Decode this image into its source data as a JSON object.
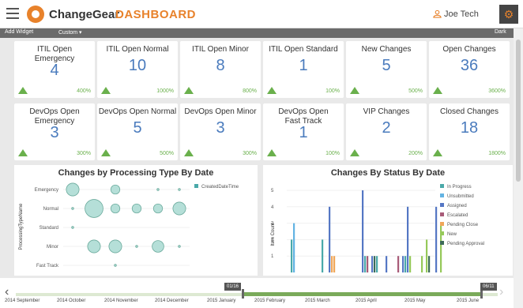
{
  "header": {
    "brand": "ChangeGear",
    "page_title": "DASHBOARD",
    "user_name": "Joe Tech"
  },
  "toolbar": {
    "add_widget": "Add Widget",
    "custom": "Custom ▾",
    "theme": "Dark"
  },
  "cards": [
    {
      "title": "ITIL Open Emergency",
      "value": "4",
      "pct": "400%"
    },
    {
      "title": "ITIL Open Normal",
      "value": "10",
      "pct": "1000%"
    },
    {
      "title": "ITIL Open Minor",
      "value": "8",
      "pct": "800%"
    },
    {
      "title": "ITIL Open Standard",
      "value": "1",
      "pct": "100%"
    },
    {
      "title": "New Changes",
      "value": "5",
      "pct": "500%"
    },
    {
      "title": "Open Changes",
      "value": "36",
      "pct": "3600%"
    },
    {
      "title": "DevOps Open Emergency",
      "value": "3",
      "pct": "300%"
    },
    {
      "title": "DevOps Open Normal",
      "value": "5",
      "pct": "500%"
    },
    {
      "title": "DevOps Open Minor",
      "value": "3",
      "pct": "300%"
    },
    {
      "title": "DevOps Open Fast Track",
      "value": "1",
      "pct": "100%"
    },
    {
      "title": "VIP Changes",
      "value": "2",
      "pct": "200%"
    },
    {
      "title": "Closed Changes",
      "value": "18",
      "pct": "1800%"
    }
  ],
  "chart_data": [
    {
      "type": "scatter",
      "title": "Changes by Processing Type By Date",
      "ylabel": "ProcessingTypeName",
      "categories": [
        "Emergency",
        "Normal",
        "Standard",
        "Minor",
        "Fast Track"
      ],
      "legend": [
        "CreatedDateTime"
      ],
      "legend_position": "top-right",
      "bubbles": [
        {
          "cat": "Emergency",
          "col": 0,
          "size": 6
        },
        {
          "cat": "Emergency",
          "col": 2,
          "size": 3
        },
        {
          "cat": "Emergency",
          "col": 4,
          "size": 1
        },
        {
          "cat": "Emergency",
          "col": 5,
          "size": 1
        },
        {
          "cat": "Normal",
          "col": 0,
          "size": 1
        },
        {
          "cat": "Normal",
          "col": 1,
          "size": 12
        },
        {
          "cat": "Normal",
          "col": 2,
          "size": 3
        },
        {
          "cat": "Normal",
          "col": 3,
          "size": 3
        },
        {
          "cat": "Normal",
          "col": 4,
          "size": 3
        },
        {
          "cat": "Normal",
          "col": 5,
          "size": 6
        },
        {
          "cat": "Standard",
          "col": 0,
          "size": 1
        },
        {
          "cat": "Minor",
          "col": 1,
          "size": 6
        },
        {
          "cat": "Minor",
          "col": 2,
          "size": 6
        },
        {
          "cat": "Minor",
          "col": 3,
          "size": 1
        },
        {
          "cat": "Minor",
          "col": 4,
          "size": 5
        },
        {
          "cat": "Minor",
          "col": 5,
          "size": 1
        },
        {
          "cat": "Fast Track",
          "col": 2,
          "size": 1
        }
      ]
    },
    {
      "type": "bar",
      "title": "Changes By Status By Date",
      "ylabel": "Item Count",
      "ylim": [
        0,
        5
      ],
      "yticks": [
        1,
        2,
        3,
        4,
        5
      ],
      "legend_position": "right",
      "series": [
        {
          "name": "In Progress",
          "color": "#4aa9a9"
        },
        {
          "name": "Unsubmitted",
          "color": "#63b3e3"
        },
        {
          "name": "Assigned",
          "color": "#5577c4"
        },
        {
          "name": "Escalated",
          "color": "#a85b78"
        },
        {
          "name": "Pending Close",
          "color": "#f0a75a"
        },
        {
          "name": "New",
          "color": "#96c95a"
        },
        {
          "name": "Pending Approval",
          "color": "#3d6b58"
        }
      ],
      "bars": [
        {
          "series": 0,
          "slot": 1,
          "value": 2
        },
        {
          "series": 1,
          "slot": 2,
          "value": 3
        },
        {
          "series": 0,
          "slot": 14,
          "value": 2
        },
        {
          "series": 2,
          "slot": 17,
          "value": 4
        },
        {
          "series": 4,
          "slot": 18,
          "value": 1
        },
        {
          "series": 4,
          "slot": 19,
          "value": 1
        },
        {
          "series": 2,
          "slot": 31,
          "value": 5
        },
        {
          "series": 0,
          "slot": 32,
          "value": 1
        },
        {
          "series": 3,
          "slot": 33,
          "value": 1
        },
        {
          "series": 2,
          "slot": 35,
          "value": 1
        },
        {
          "series": 6,
          "slot": 36,
          "value": 1
        },
        {
          "series": 0,
          "slot": 37,
          "value": 1
        },
        {
          "series": 2,
          "slot": 41,
          "value": 1
        },
        {
          "series": 3,
          "slot": 46,
          "value": 1
        },
        {
          "series": 2,
          "slot": 48,
          "value": 1
        },
        {
          "series": 0,
          "slot": 49,
          "value": 1
        },
        {
          "series": 2,
          "slot": 50,
          "value": 4
        },
        {
          "series": 5,
          "slot": 51,
          "value": 1
        },
        {
          "series": 5,
          "slot": 56,
          "value": 1
        },
        {
          "series": 5,
          "slot": 58,
          "value": 2
        },
        {
          "series": 6,
          "slot": 59,
          "value": 1
        },
        {
          "series": 2,
          "slot": 62,
          "value": 4
        },
        {
          "series": 5,
          "slot": 64,
          "value": 3
        }
      ]
    }
  ],
  "timeline": {
    "start_tag": "01/16",
    "end_tag": "06/11",
    "labels": [
      "2014 September",
      "2014 October",
      "2014 November",
      "2014 December",
      "2015 January",
      "2015 February",
      "2015 March",
      "2015 April",
      "2015 May",
      "2015 June"
    ]
  },
  "colors": {
    "accent": "#e8822b",
    "value_blue": "#4a7bbd",
    "up_green": "#6ab04c"
  }
}
